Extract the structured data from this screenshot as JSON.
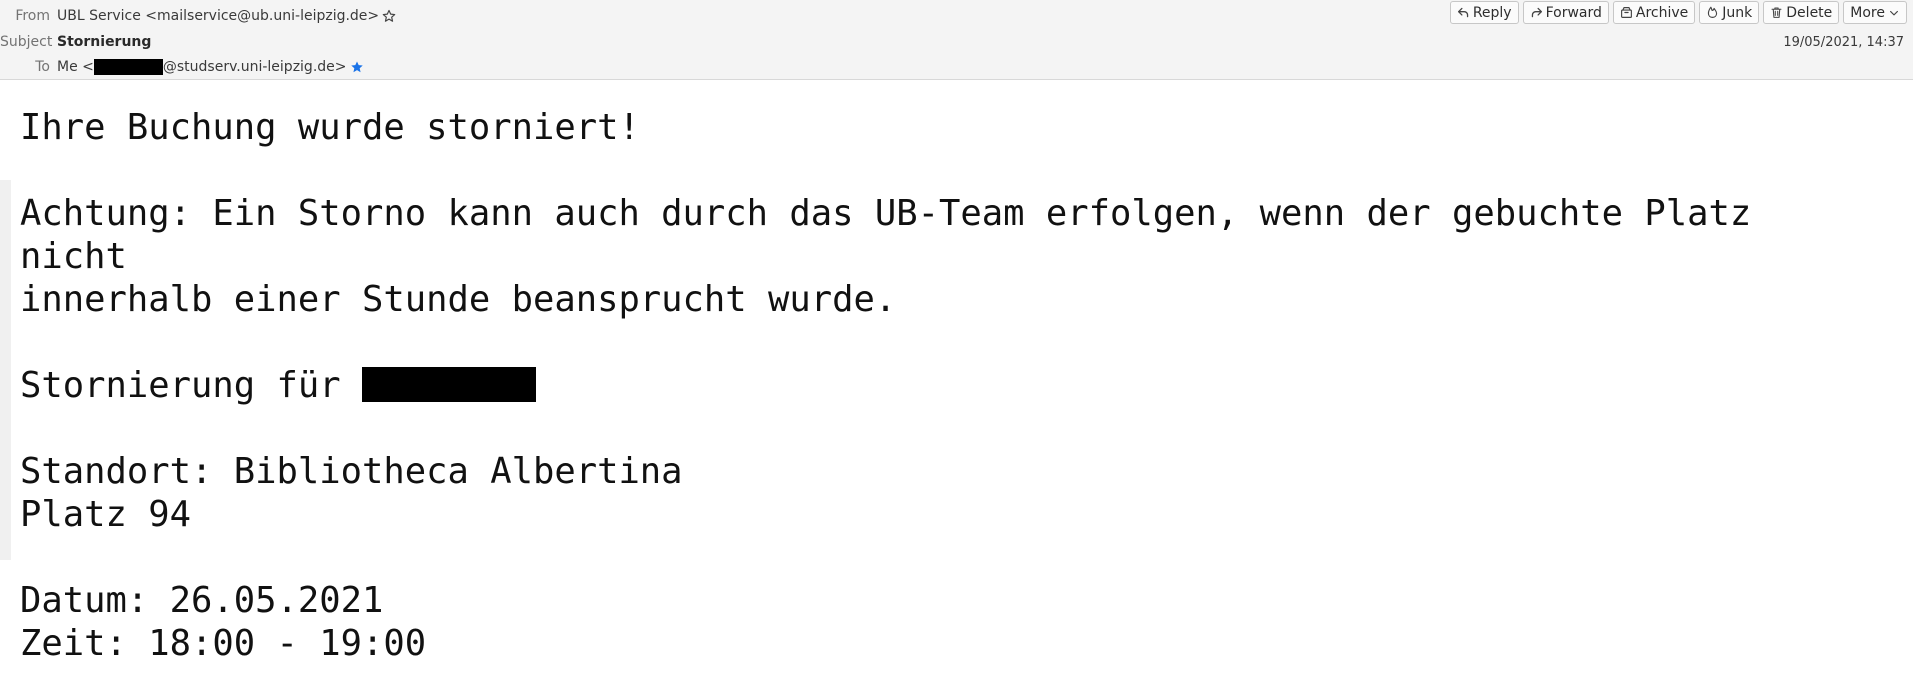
{
  "header": {
    "from_label": "From",
    "from_value": "UBL Service <mailservice@ub.uni-leipzig.de>",
    "subject_label": "Subject",
    "subject_value": "Stornierung",
    "to_label": "To",
    "to_prefix": "Me <",
    "to_suffix": "@studserv.uni-leipzig.de>",
    "date": "19/05/2021, 14:37"
  },
  "toolbar": {
    "reply": "Reply",
    "forward": "Forward",
    "archive": "Archive",
    "junk": "Junk",
    "delete": "Delete",
    "more": "More"
  },
  "message": {
    "line1": "Ihre Buchung wurde storniert!",
    "line2": "Achtung: Ein Storno kann auch durch das UB-Team erfolgen, wenn der gebuchte Platz",
    "line3": "nicht",
    "line4": "innerhalb einer Stunde beansprucht wurde.",
    "line5_prefix": "Stornierung für ",
    "line6": "Standort: Bibliotheca Albertina",
    "line7": "Platz 94",
    "line8": "Datum: 26.05.2021",
    "line9": "Zeit: 18:00 - 19:00"
  },
  "icons": {
    "from_star": "star-outline-icon",
    "to_star": "star-filled-icon",
    "to_star_color": "#1a73e8"
  }
}
